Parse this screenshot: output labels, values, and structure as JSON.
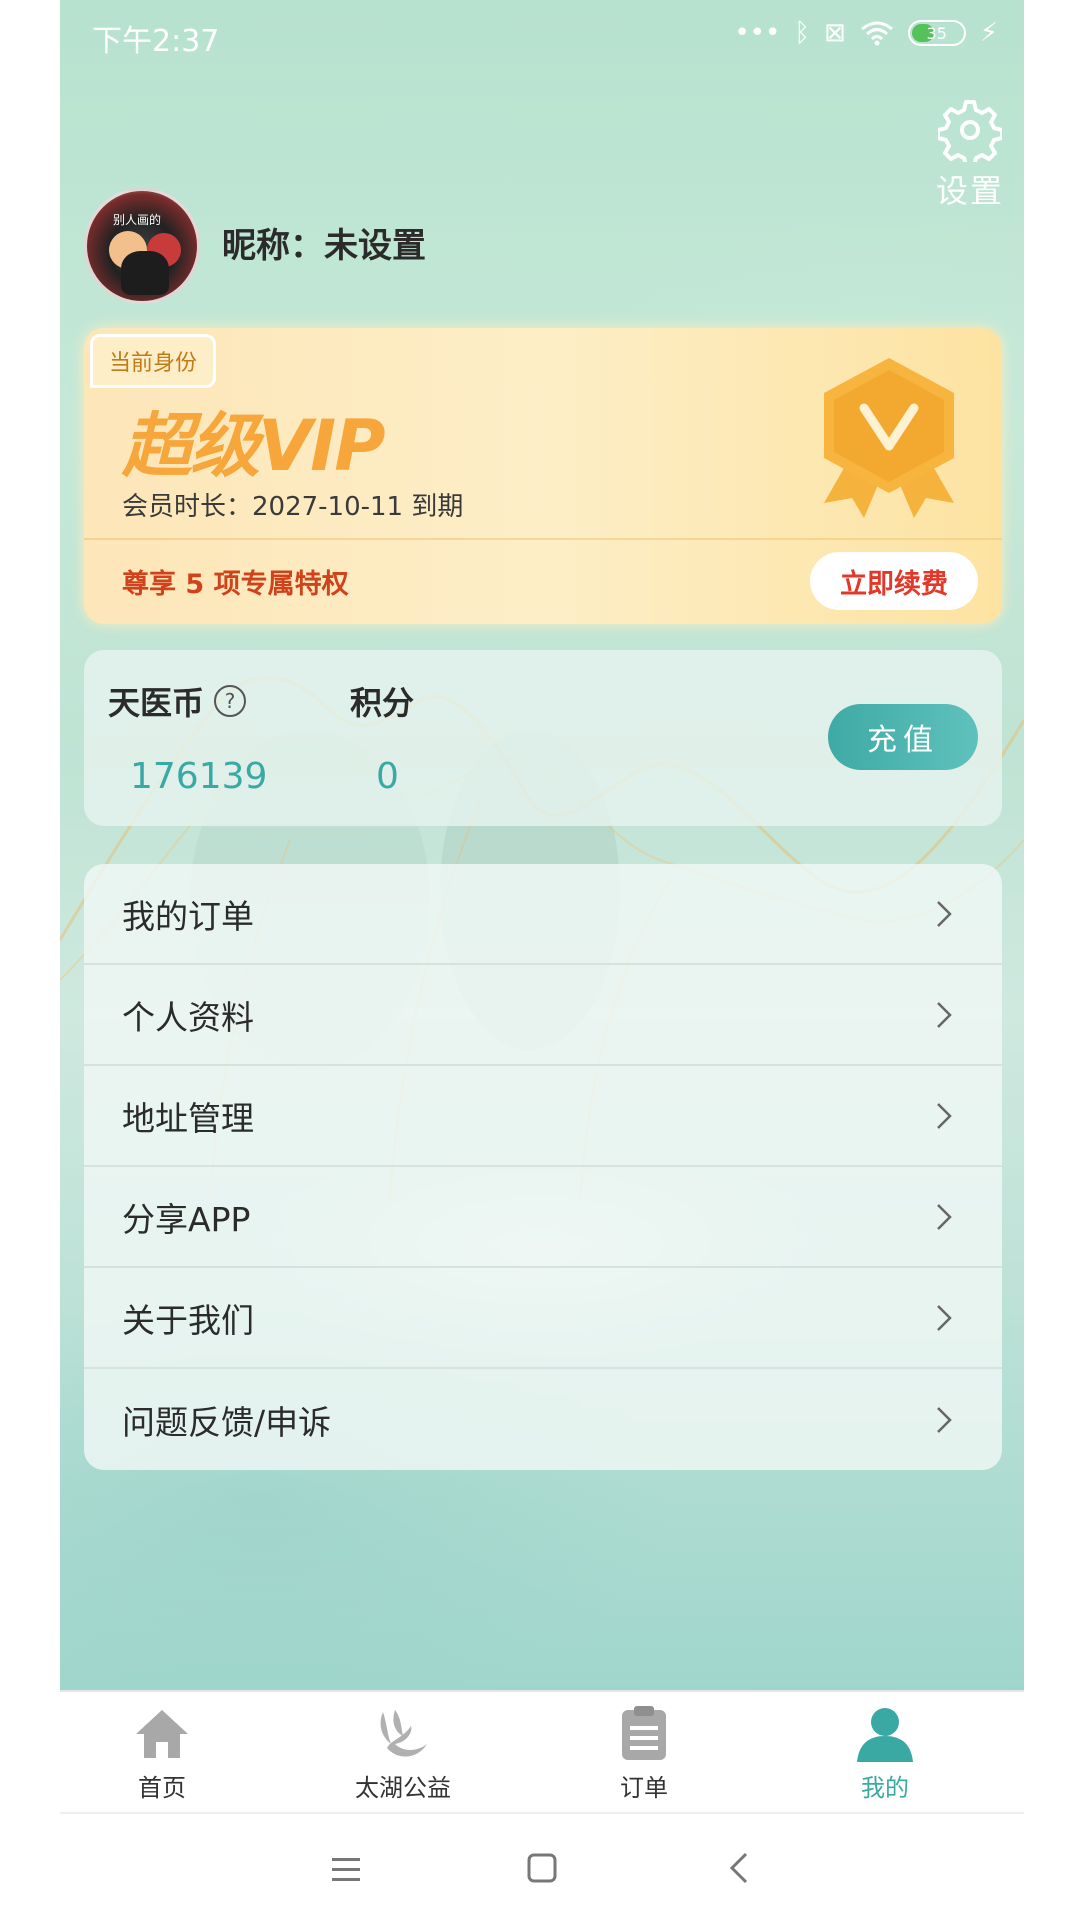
{
  "status_bar": {
    "time": "下午2:37",
    "battery_level": "35",
    "icons": [
      "more-dots-icon",
      "bluetooth-icon",
      "sim-off-icon",
      "wifi-icon",
      "battery-icon",
      "charging-icon"
    ]
  },
  "header": {
    "settings_label": "设置"
  },
  "profile": {
    "nickname": "昵称：未设置",
    "avatar_text": "别人画的"
  },
  "vip": {
    "tag": "当前身份",
    "title": "超级VIP",
    "expiry": "会员时长：2027-10-11 到期",
    "perks": "尊享 5 项专属特权",
    "renew_label": "立即续费",
    "accent_color": "#f6a63a"
  },
  "wallet": {
    "coin_label": "天医币",
    "coin_value": "176139",
    "points_label": "积分",
    "points_value": "0",
    "recharge_label": "充值",
    "accent_color": "#3aa9a4"
  },
  "menu": {
    "items": [
      {
        "label": "我的订单"
      },
      {
        "label": "个人资料"
      },
      {
        "label": "地址管理"
      },
      {
        "label": "分享APP"
      },
      {
        "label": "关于我们"
      },
      {
        "label": "问题反馈/申诉"
      }
    ]
  },
  "bottom_nav": {
    "items": [
      {
        "label": "首页",
        "icon": "home-icon"
      },
      {
        "label": "太湖公益",
        "icon": "charity-icon"
      },
      {
        "label": "订单",
        "icon": "clipboard-icon"
      },
      {
        "label": "我的",
        "icon": "user-icon",
        "active": true
      }
    ]
  }
}
